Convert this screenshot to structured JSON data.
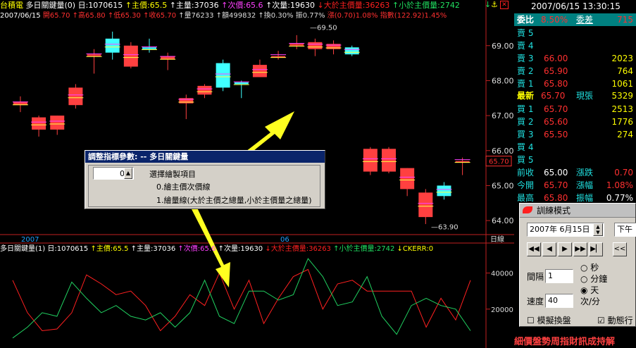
{
  "header": {
    "stock": "台積電",
    "indicator_title": "多日關鍵量(0)",
    "date_label": "日:1070615",
    "main_price": "↑主價:65.5",
    "main_vol": "↑主量:37036",
    "sub_price": "↑次價:65.6",
    "sub_vol": "↑次量:19630",
    "above_vol": "↓大於主價量:36263",
    "below_vol": "↑小於主價量:2742",
    "down_arrow": "↓"
  },
  "subheader": {
    "date": "2007/06/15",
    "open": "開65.70",
    "high": "↑高65.80",
    "low": "↑低65.30",
    "close": "↑收65.70",
    "volume": "↑量76233",
    "amount": "↑額499832",
    "turnover": "↑換0.30%",
    "amplitude": "振0.77%",
    "change": "漲(0.70)1.08%",
    "index": "指數(122.92)1.45%"
  },
  "lower_header": {
    "title": "多日關鍵量(1)",
    "date_label": "日:1070615",
    "main_price": "↑主價:65.5",
    "main_vol": "↑主量:37036",
    "sub_price": "↑次價:65.6",
    "sub_vol": "↑次量:19630",
    "above_vol": "↓大於主價量:36263",
    "below_vol": "↑小於主價量:2742",
    "ckerr": "↓CKERR:0"
  },
  "price_axis": [
    "69.00",
    "68.00",
    "67.00",
    "66.00",
    "65.00",
    "64.00"
  ],
  "current_price_tag": "65.70",
  "high_label": "69.50",
  "low_label": "63.90",
  "x_axis": {
    "year": "2007",
    "month": "06",
    "period": "日線"
  },
  "vol_axis": [
    "40000",
    "20000"
  ],
  "chart_data": {
    "type": "candlestick",
    "price_ylim": [
      63.7,
      69.7
    ],
    "candles": [
      {
        "o": 67.3,
        "h": 67.55,
        "l": 67.1,
        "c": 67.4
      },
      {
        "o": 66.6,
        "h": 67.0,
        "l": 66.4,
        "c": 66.95
      },
      {
        "o": 66.6,
        "h": 67.0,
        "l": 66.45,
        "c": 67.0
      },
      {
        "o": 67.3,
        "h": 67.9,
        "l": 67.2,
        "c": 67.8
      },
      {
        "o": 68.7,
        "h": 68.9,
        "l": 68.2,
        "c": 68.75
      },
      {
        "o": 69.2,
        "h": 69.4,
        "l": 68.6,
        "c": 68.8
      },
      {
        "o": 68.4,
        "h": 69.1,
        "l": 68.35,
        "c": 69.0
      },
      {
        "o": 68.95,
        "h": 69.2,
        "l": 68.8,
        "c": 68.9
      },
      {
        "o": 68.6,
        "h": 68.8,
        "l": 68.3,
        "c": 68.7
      },
      {
        "o": 67.35,
        "h": 67.6,
        "l": 66.9,
        "c": 67.5
      },
      {
        "o": 67.6,
        "h": 67.9,
        "l": 67.5,
        "c": 67.85
      },
      {
        "o": 68.5,
        "h": 68.6,
        "l": 67.7,
        "c": 67.8
      },
      {
        "o": 67.95,
        "h": 68.0,
        "l": 67.5,
        "c": 67.9
      },
      {
        "o": 68.1,
        "h": 68.6,
        "l": 68.1,
        "c": 68.45
      },
      {
        "o": 68.7,
        "h": 68.85,
        "l": 68.6,
        "c": 68.7
      },
      {
        "o": 69.0,
        "h": 69.3,
        "l": 68.9,
        "c": 69.05
      },
      {
        "o": 68.9,
        "h": 69.2,
        "l": 68.7,
        "c": 69.1
      },
      {
        "o": 68.9,
        "h": 69.15,
        "l": 68.75,
        "c": 69.05
      },
      {
        "o": 68.95,
        "h": 69.0,
        "l": 68.7,
        "c": 68.75
      },
      {
        "o": 65.4,
        "h": 66.1,
        "l": 65.3,
        "c": 66.05
      },
      {
        "o": 65.4,
        "h": 66.1,
        "l": 65.35,
        "c": 66.05
      },
      {
        "o": 64.9,
        "h": 65.5,
        "l": 64.7,
        "c": 65.5
      },
      {
        "o": 64.1,
        "h": 64.9,
        "l": 63.9,
        "c": 64.8
      },
      {
        "o": 65.0,
        "h": 65.1,
        "l": 64.6,
        "c": 64.7
      },
      {
        "o": 65.7,
        "h": 65.8,
        "l": 65.3,
        "c": 65.7
      }
    ],
    "vol_ylim": [
      0,
      50000
    ],
    "series": [
      {
        "name": "大於主價量",
        "color": "#ff2020",
        "values": [
          36000,
          18000,
          8000,
          9000,
          18000,
          39000,
          34000,
          28000,
          30000,
          22000,
          8000,
          16000,
          28000,
          22000,
          40000,
          20000,
          36000,
          12000,
          26000,
          38000,
          42000,
          20000,
          34000,
          36000,
          30000,
          30000,
          30000,
          30000,
          10000,
          26000,
          14000,
          36000
        ]
      },
      {
        "name": "小於主價量",
        "color": "#20d060",
        "values": [
          4000,
          10000,
          18000,
          16000,
          35000,
          26000,
          18000,
          22000,
          16000,
          14000,
          18000,
          10000,
          18000,
          36000,
          16000,
          12000,
          30000,
          30000,
          25000,
          28000,
          48000,
          38000,
          22000,
          24000,
          38000,
          16000,
          6000,
          22000,
          26000,
          22000,
          20000,
          8000
        ]
      }
    ]
  },
  "quote": {
    "datetime": "2007/06/15 13:30:15",
    "ratio_label": "委比",
    "ratio": "8.50%",
    "diff_label": "委差",
    "diff": "715",
    "rows": [
      {
        "label": "賣 5",
        "price": "",
        "vol": ""
      },
      {
        "label": "賣 4",
        "price": "",
        "vol": ""
      },
      {
        "label": "賣 3",
        "price": "66.00",
        "vol": "2023"
      },
      {
        "label": "賣 2",
        "price": "65.90",
        "vol": "764"
      },
      {
        "label": "賣 1",
        "price": "65.80",
        "vol": "1061"
      }
    ],
    "latest_label": "最新",
    "latest": "65.70",
    "tick_label": "現張",
    "tick": "5329",
    "buy_rows": [
      {
        "label": "買 1",
        "price": "65.70",
        "vol": "2513"
      },
      {
        "label": "買 2",
        "price": "65.60",
        "vol": "1776"
      },
      {
        "label": "買 3",
        "price": "65.50",
        "vol": "274"
      },
      {
        "label": "買 4",
        "price": "",
        "vol": ""
      },
      {
        "label": "買 5",
        "price": "",
        "vol": ""
      }
    ],
    "prev_label": "前收",
    "prev": "65.00",
    "chg_label": "漲跌",
    "chg": "0.70",
    "open_label": "今開",
    "open": "65.70",
    "pct_label": "漲幅",
    "pct": "1.08%",
    "high_label": "最高",
    "high": "65.80",
    "amp_label": "振幅",
    "amp": "0.77%"
  },
  "dialog_params": {
    "title": "調整指標參數: -- 多日關鍵量",
    "value": "0",
    "option_title": "選擇繪製項目",
    "option0": "0.繪主價次價線",
    "option1": "1.繪量線(大於主價之總量,小於主價量之總量)"
  },
  "dialog_train": {
    "title": "訓練模式",
    "date": "2007年 6月15日",
    "ampm": "下午",
    "interval_label": "間隔",
    "interval": "1",
    "unit_sec": "秒",
    "unit_min": "分鐘",
    "unit_day": "天",
    "speed_label": "速度",
    "speed": "40",
    "speed_unit": "次/分",
    "simulate": "模擬換盤",
    "dynamic": "動態行"
  },
  "bottom_text": "細價盤勢周指財訊成持解"
}
